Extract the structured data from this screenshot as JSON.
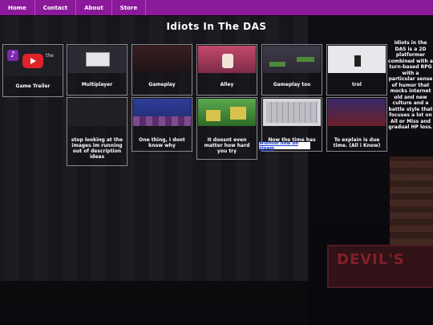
{
  "nav": {
    "items": [
      {
        "label": "Home"
      },
      {
        "label": "Contact"
      },
      {
        "label": "About"
      },
      {
        "label": "Store"
      }
    ]
  },
  "page": {
    "title": "Idiots In The DAS"
  },
  "gallery": {
    "row1": [
      {
        "caption": "Game Trailer",
        "icon": "play-icon",
        "overlay_text": "the"
      },
      {
        "caption": "Multiplayer"
      },
      {
        "caption": "Gameplay"
      },
      {
        "caption": "Alley"
      },
      {
        "caption": "Gameplay too"
      },
      {
        "caption": "trol"
      }
    ],
    "row2": [
      {
        "caption": "stop looking at the images im running out of description ideas"
      },
      {
        "caption": "One thing, I dont know why"
      },
      {
        "caption": "It doesnt even matter how hard you try"
      },
      {
        "caption": "Now the time has come I"
      },
      {
        "caption": "To explain is due time. (All i Know)"
      }
    ]
  },
  "wishlist_label": "Wishlist now on steam",
  "description": "Idiots in the DAS is a 2D platformer combined with a turn-based RPG with a particular sense of humor that mocks internet old and new culture and a battle style that focuses a lot on All or Miss and gradual HP loss.",
  "background_sign": "DEVIL'S",
  "colors": {
    "nav": "#8a1a9a",
    "trailer_play": "#e0222a"
  }
}
